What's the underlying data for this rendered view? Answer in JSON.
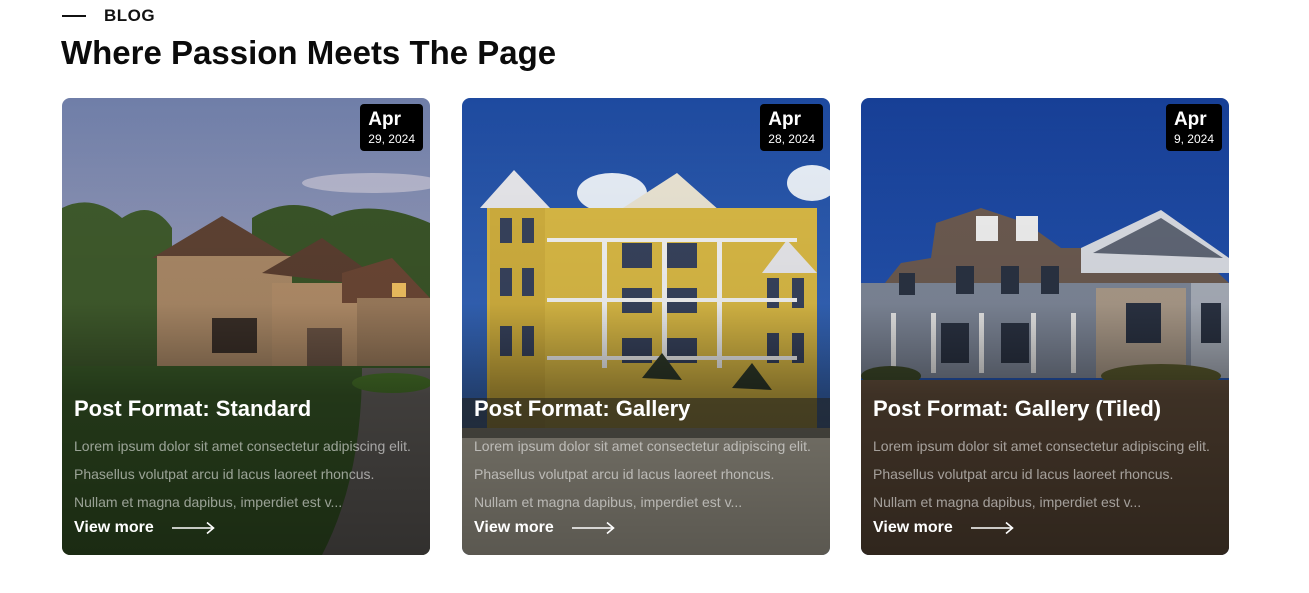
{
  "section": {
    "eyebrow": "BLOG",
    "title": "Where Passion Meets The Page"
  },
  "posts": [
    {
      "month": "Apr",
      "day_year": "29, 2024",
      "title": "Post Format: Standard",
      "excerpt": "Lorem ipsum dolor sit amet consectetur adipiscing elit. Phasellus volutpat arcu id lacus laoreet rhoncus. Nullam et magna dapibus, imperdiet est v...",
      "cta": "View more",
      "image_icon": "brick-house-photo"
    },
    {
      "month": "Apr",
      "day_year": "28, 2024",
      "title": "Post Format: Gallery",
      "excerpt": "Lorem ipsum dolor sit amet consectetur adipiscing elit. Phasellus volutpat arcu id lacus laoreet rhoncus. Nullam et magna dapibus, imperdiet est v...",
      "cta": "View more",
      "image_icon": "yellow-beach-house-photo"
    },
    {
      "month": "Apr",
      "day_year": "9, 2024",
      "title": "Post Format: Gallery (Tiled)",
      "excerpt": "Lorem ipsum dolor sit amet consectetur adipiscing elit. Phasellus volutpat arcu id lacus laoreet rhoncus. Nullam et magna dapibus, imperdiet est v...",
      "cta": "View more",
      "image_icon": "gray-suburban-house-photo"
    }
  ],
  "colors": {
    "heading": "#0b0b0b",
    "date_badge": "#000000",
    "card_text": "#ffffff"
  }
}
